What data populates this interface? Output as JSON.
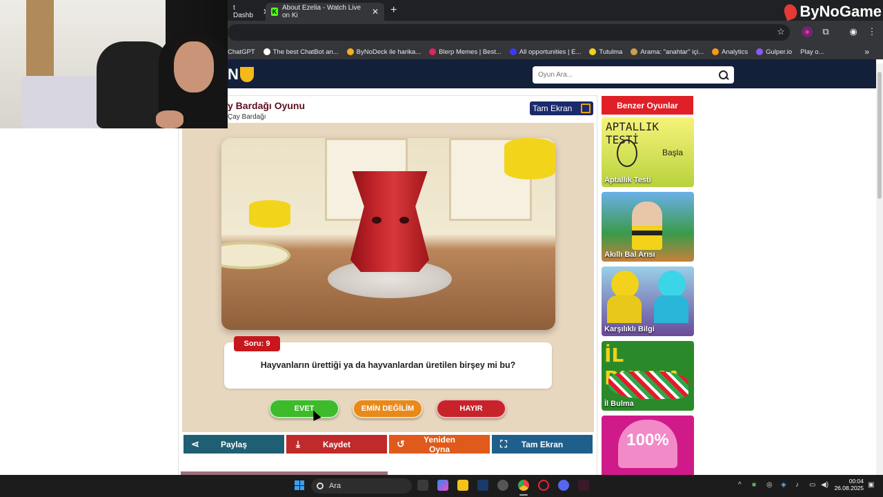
{
  "browser": {
    "tabs": [
      {
        "title": "t Dashb",
        "active": false
      },
      {
        "title": "About Ezelia - Watch Live on Ki",
        "active": true
      }
    ],
    "bookmarks": [
      {
        "label": "ChatGPT",
        "color": "#ffffff"
      },
      {
        "label": "The best ChatBot an...",
        "color": "#ffffff"
      },
      {
        "label": "ByNoDeck ile harika...",
        "color": "#f2b01a"
      },
      {
        "label": "Blerp Memes | Best...",
        "color": "#e0245e"
      },
      {
        "label": "All opportunities | E...",
        "color": "#3a3aff"
      },
      {
        "label": "Tutulma",
        "color": "#f2d21a"
      },
      {
        "label": "Arama: \"anahtar\" içi...",
        "color": "#c8a050"
      },
      {
        "label": "Analytics",
        "color": "#f29a1a"
      },
      {
        "label": "Gulper.io",
        "color": "#8a5af2"
      },
      {
        "label": "Play o...",
        "color": "#e04ad0"
      }
    ],
    "overlay_brand": "ByNoGame"
  },
  "site": {
    "logo_text": "N",
    "search_placeholder": "Oyun Ara..."
  },
  "game": {
    "title": "y Bardağı Oyunu",
    "subtitle": "Çay Bardağı",
    "fullscreen_label": "Tam Ekran",
    "question_badge": "Soru: 9",
    "question": "Hayvanların ürettiği ya da hayvanlardan üretilen birşey mi bu?",
    "answers": {
      "yes": "EVET",
      "unsure": "EMİN DEĞİLİM",
      "no": "HAYIR"
    },
    "actions": {
      "share": "Paylaş",
      "save": "Kaydet",
      "replay": "Yeniden Oyna",
      "fullscreen": "Tam Ekran"
    }
  },
  "sidebar": {
    "heading": "Benzer Oyunlar",
    "games": [
      {
        "title": "Aptallık Testi",
        "thumb_text": "APTALLIK TESTİ",
        "thumb_sub": "Başla"
      },
      {
        "title": "Akıllı Bal Arısı"
      },
      {
        "title": "Karşılıklı Bilgi"
      },
      {
        "title": "İl Bulma",
        "thumb_text": "İL BULMA"
      },
      {
        "title": "",
        "thumb_text": "100%"
      }
    ]
  },
  "taskbar": {
    "search_label": "Ara",
    "time": "00:04",
    "date": "26.08.2025"
  },
  "colors": {
    "header_bg": "#13203a",
    "accent_red": "#e01f26",
    "yes_green": "#3dbb2a",
    "unsure_orange": "#e8891a",
    "no_red": "#c8232a"
  }
}
